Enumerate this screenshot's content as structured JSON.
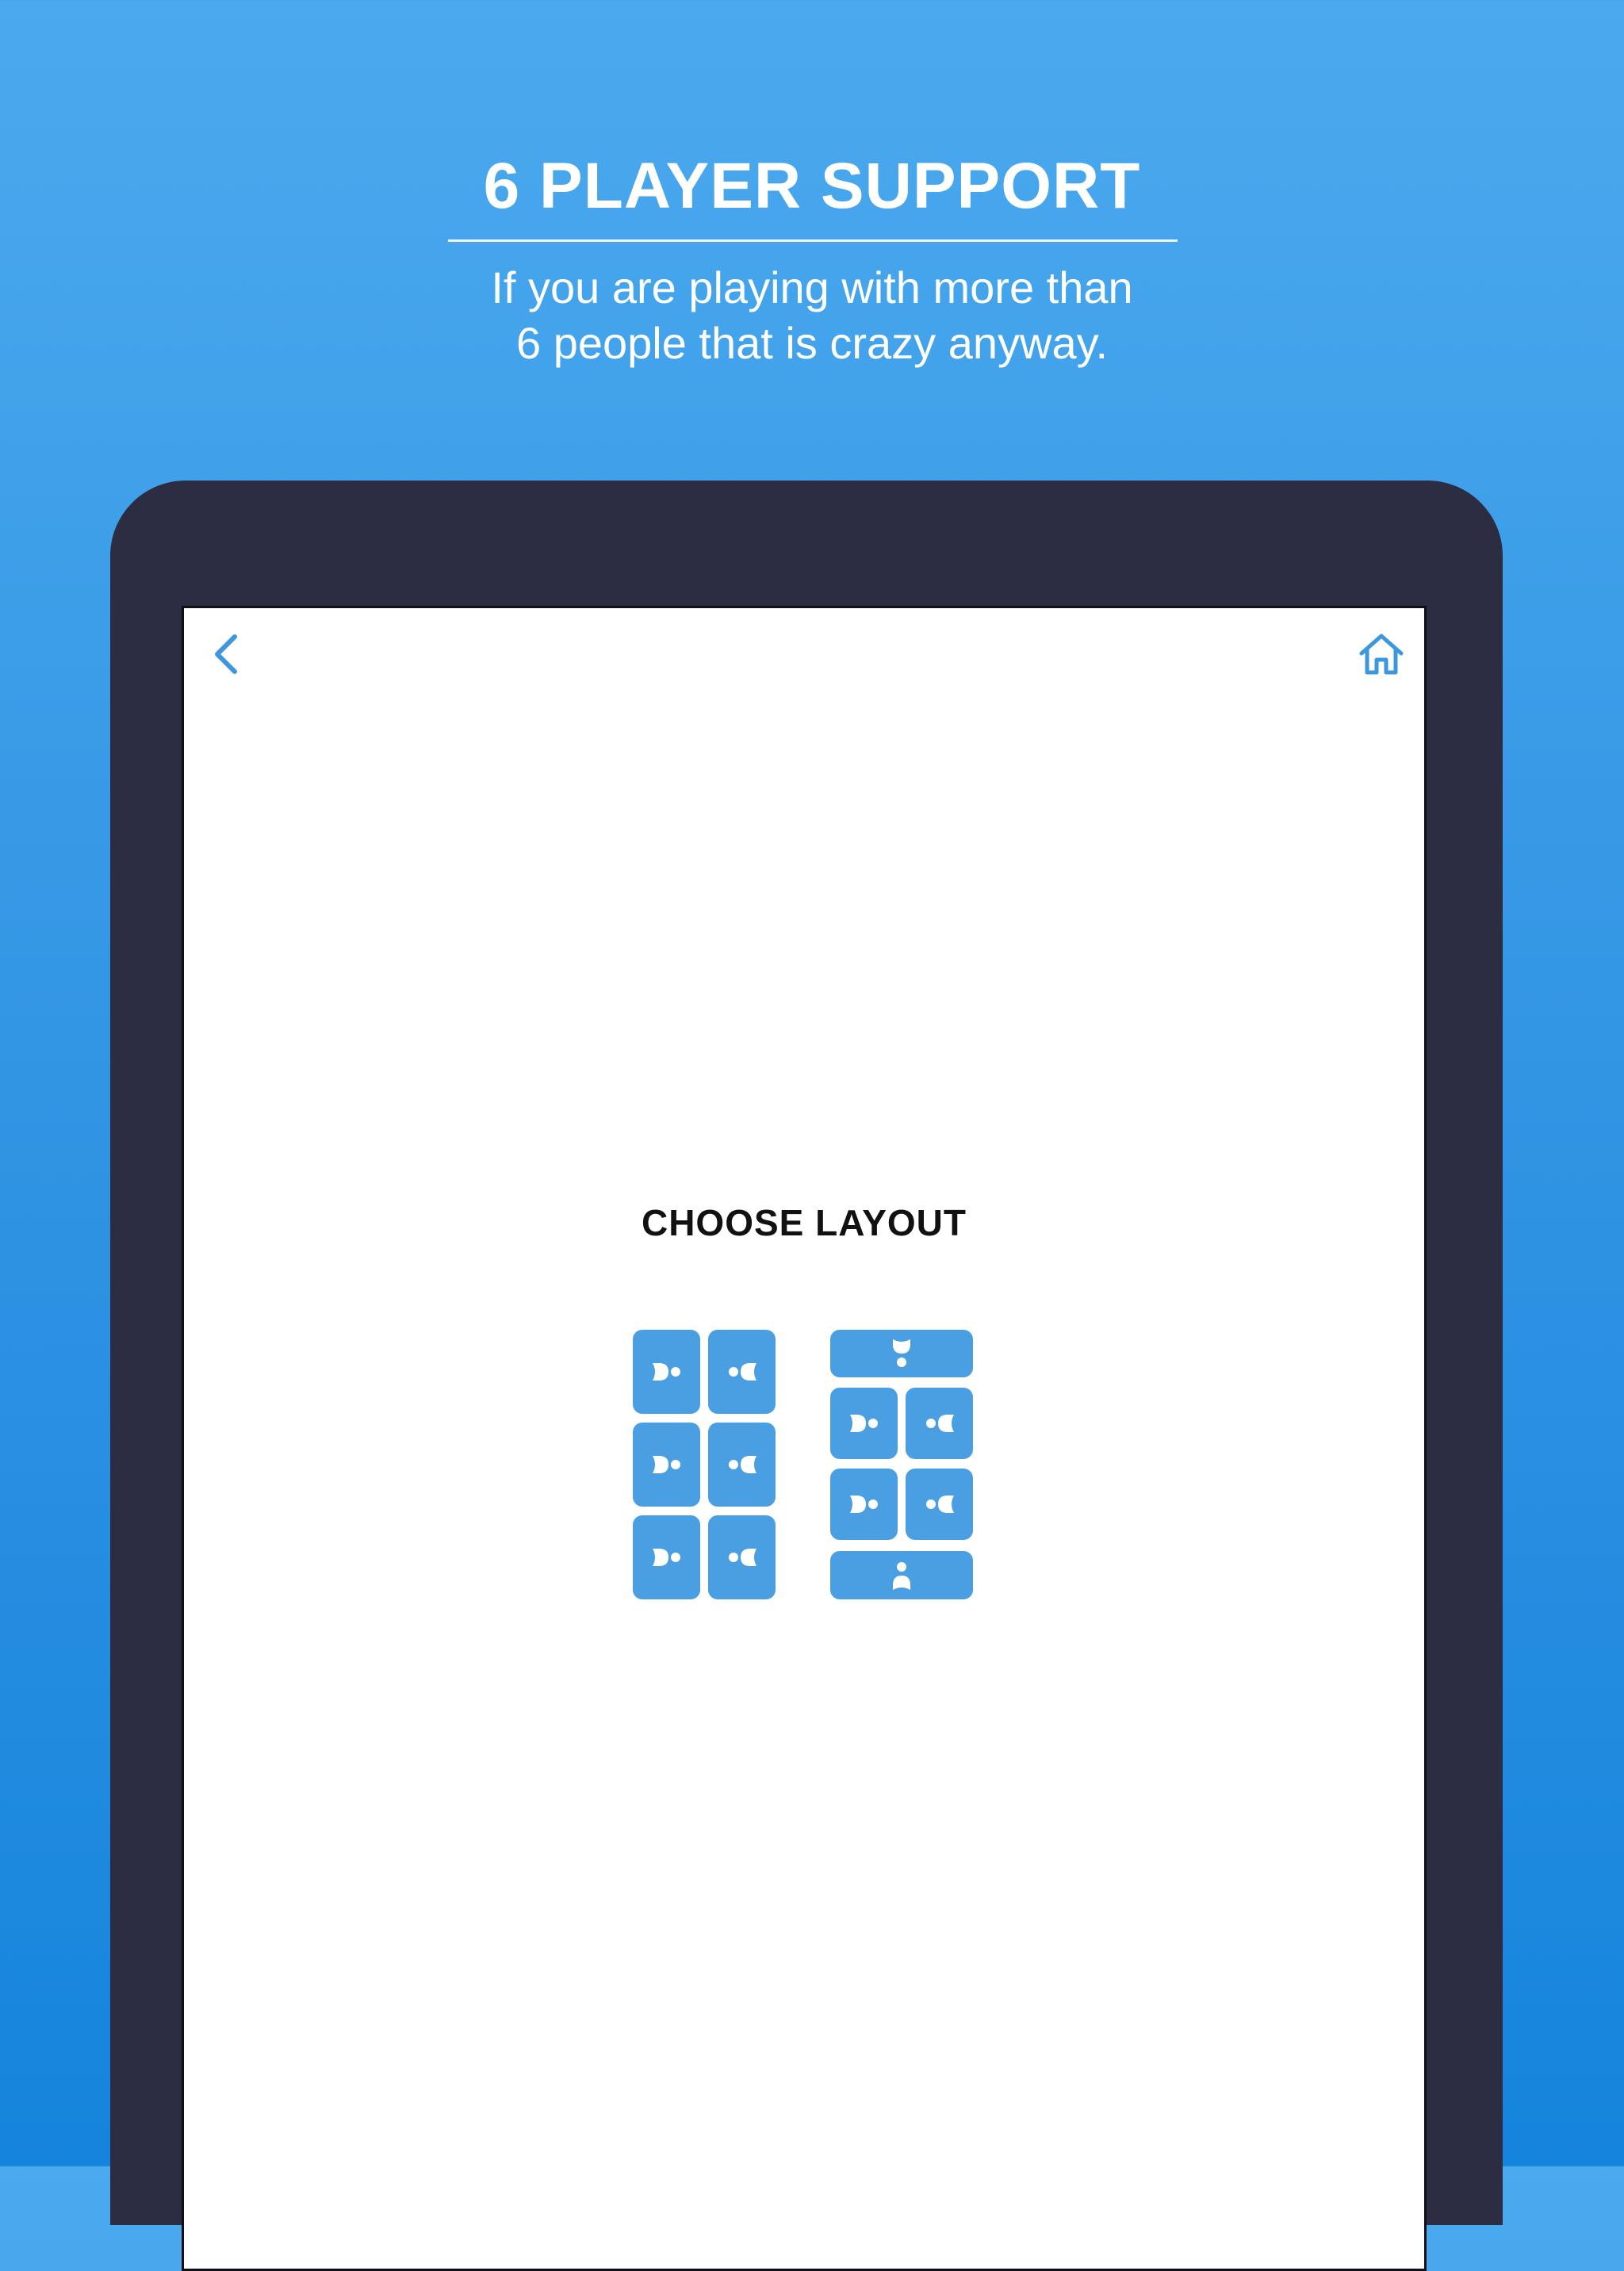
{
  "promo": {
    "title": "6 PLAYER SUPPORT",
    "subtitle_line1": "If you are playing with more than",
    "subtitle_line2": "6 people that is crazy anyway."
  },
  "screen": {
    "nav": {
      "back_icon": "chevron-left-icon",
      "home_icon": "home-icon"
    },
    "title": "CHOOSE LAYOUT",
    "layouts": [
      {
        "name": "layout-grid-6",
        "tiles": [
          "player-facing-right",
          "player-facing-left",
          "player-facing-right",
          "player-facing-left",
          "player-facing-right",
          "player-facing-left"
        ]
      },
      {
        "name": "layout-grid-4-plus-ends",
        "tiles": [
          "player-facing-down",
          "player-facing-right",
          "player-facing-left",
          "player-facing-right",
          "player-facing-left",
          "player-facing-up"
        ]
      }
    ]
  },
  "colors": {
    "background_top": "#4ba9ee",
    "background_bottom": "#1584dc",
    "device_frame": "#2c2c42",
    "accent": "#4a9fe2",
    "title_text": "#111111"
  }
}
